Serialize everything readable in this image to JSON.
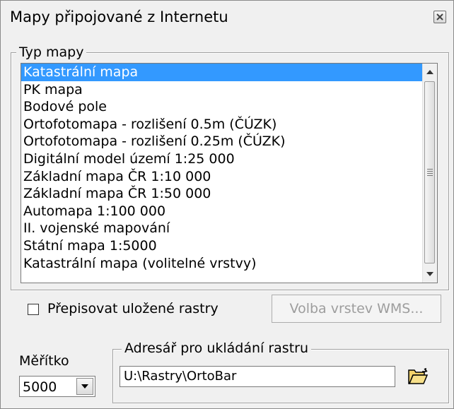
{
  "window": {
    "title": "Mapy připojované z  Internetu"
  },
  "map_type": {
    "legend": "Typ mapy",
    "selected_index": 0,
    "items": [
      "Katastrální mapa",
      "PK mapa",
      "Bodové pole",
      "Ortofotomapa - rozlišení 0.5m (ČÚZK)",
      "Ortofotomapa - rozlišení 0.25m (ČÚZK)",
      "Digitální model území 1:25 000",
      "Základní mapa ČR 1:10 000",
      "Základní mapa ČR 1:50 000",
      "Automapa 1:100 000",
      "II. vojenské mapování",
      "Státní mapa 1:5000",
      "Katastrální mapa (volitelné vrstvy)"
    ]
  },
  "options": {
    "overwrite_label": "Přepisovat uložené rastry",
    "overwrite_checked": false,
    "wms_button_label": "Volba vrstev WMS..."
  },
  "scale": {
    "label": "Měřítko",
    "value": "5000"
  },
  "directory": {
    "legend": "Adresář pro ukládání rastru",
    "path": "U:\\Rastry\\OrtoBar"
  },
  "colors": {
    "selection": "#3399ff",
    "disabled_text": "#9d9d9d"
  }
}
